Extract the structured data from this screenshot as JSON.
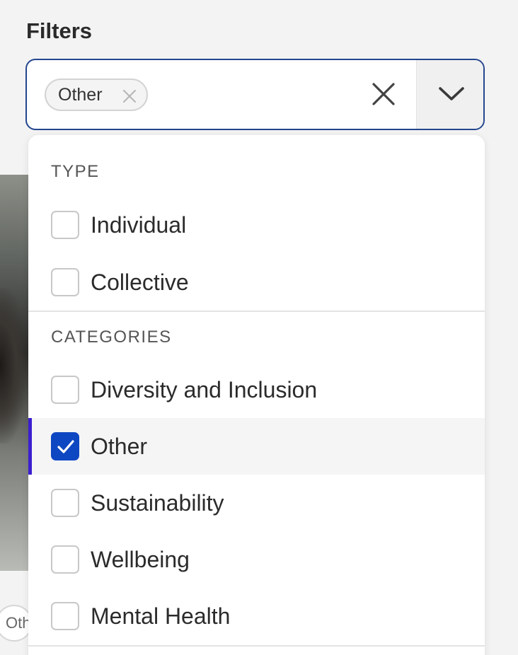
{
  "filters": {
    "title": "Filters"
  },
  "select": {
    "selected_chips": [
      {
        "label": "Other"
      }
    ]
  },
  "menu": {
    "groups": [
      {
        "label": "TYPE",
        "options": [
          {
            "label": "Individual",
            "checked": false
          },
          {
            "label": "Collective",
            "checked": false
          }
        ]
      },
      {
        "label": "CATEGORIES",
        "options": [
          {
            "label": "Diversity and Inclusion",
            "checked": false
          },
          {
            "label": "Other",
            "checked": true
          },
          {
            "label": "Sustainability",
            "checked": false
          },
          {
            "label": "Wellbeing",
            "checked": false
          },
          {
            "label": "Mental Health",
            "checked": false
          }
        ]
      }
    ]
  },
  "background": {
    "chip_partial_text": "Oth"
  },
  "colors": {
    "focus_border": "#25468f",
    "checkbox_checked": "#0e47c2",
    "selected_indicator": "#3b1fd1"
  },
  "icons": {
    "chip_remove": "close-icon",
    "clear": "close-icon",
    "toggle": "chevron-down-icon",
    "check": "check-icon"
  }
}
